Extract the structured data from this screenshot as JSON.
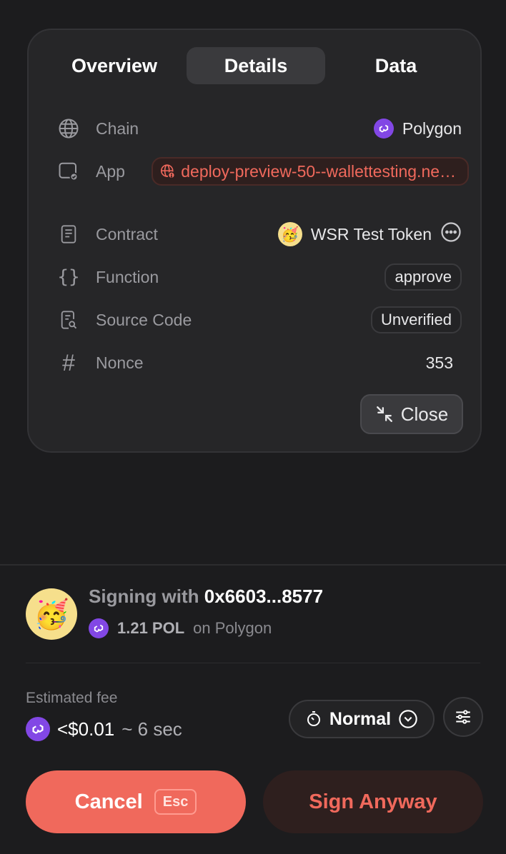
{
  "tabs": [
    {
      "label": "Overview"
    },
    {
      "label": "Details"
    },
    {
      "label": "Data"
    }
  ],
  "details": {
    "chain": {
      "label": "Chain",
      "value": "Polygon"
    },
    "app": {
      "label": "App",
      "value": "deploy-preview-50--wallettesting.netlify.app"
    },
    "contract": {
      "label": "Contract",
      "value": "WSR Test Token"
    },
    "function": {
      "label": "Function",
      "value": "approve"
    },
    "source_code": {
      "label": "Source Code",
      "value": "Unverified"
    },
    "nonce": {
      "label": "Nonce",
      "value": "353"
    }
  },
  "close_label": "Close",
  "signer": {
    "prefix": "Signing with",
    "address": "0x6603...8577",
    "balance": "1.21 POL",
    "network": "on Polygon"
  },
  "fee": {
    "label": "Estimated fee",
    "amount": "<$0.01",
    "time": "~ 6 sec",
    "speed": "Normal"
  },
  "actions": {
    "cancel": "Cancel",
    "cancel_shortcut": "Esc",
    "sign": "Sign Anyway"
  },
  "colors": {
    "accent": "#f0695c",
    "polygon": "#8247e5",
    "background": "#1c1c1e",
    "card": "#262628"
  }
}
